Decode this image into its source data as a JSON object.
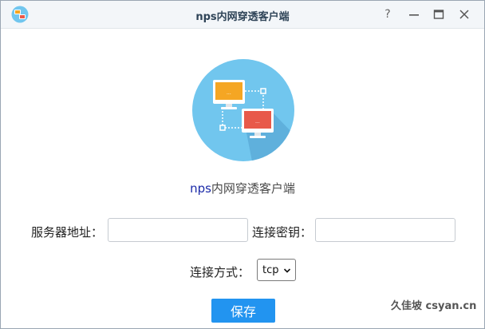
{
  "window": {
    "title": "nps内网穿透客户端",
    "help_glyph": "?",
    "minimize_glyph": "",
    "maximize_glyph": "",
    "close_glyph": ""
  },
  "app": {
    "name_prefix": "nps",
    "name_suffix": "内网穿透客户端"
  },
  "form": {
    "server_label": "服务器地址：",
    "server_value": "",
    "key_label": "连接密钥：",
    "key_value": "",
    "mode_label": "连接方式：",
    "mode_selected": "tcp",
    "save_label": "保存"
  },
  "watermark": "久佳坡 csyan.cn",
  "colors": {
    "accent": "#2294f0",
    "hero_circle": "#71c6ee",
    "monitor_orange": "#f5a623",
    "monitor_red": "#e8594a",
    "title_text": "#2f4458"
  }
}
